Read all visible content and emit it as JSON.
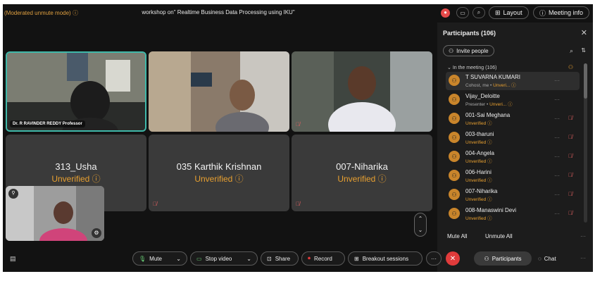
{
  "top": {
    "moderated_mode": "(Moderated unmute mode) ⓘ",
    "meeting_title": "workshop on\" Realtime Business Data Processing using IKU\"",
    "rec_dot": "⏺",
    "layout_label": "Layout",
    "meeting_info_label": "Meeting info"
  },
  "tiles": [
    {
      "name": "Dr. R RAVINDER REDDY Professor"
    },
    {
      "name": ""
    },
    {
      "name": ""
    },
    {
      "name": "313_Usha",
      "status": "Unverified ⓘ"
    },
    {
      "name": "035 Karthik Krishnan",
      "status": "Unverified ⓘ"
    },
    {
      "name": "007-Niharika",
      "status": "Unverified ⓘ"
    }
  ],
  "panel": {
    "title": "Participants (106)",
    "invite_label": "Invite people",
    "section": "In the meeting (106)",
    "participants": [
      {
        "name": "T SUVARNA KUMARI",
        "role": "Cohost, me",
        "status": "Unveri... ⓘ"
      },
      {
        "name": "Vijay_Deloitte",
        "role": "Presenter",
        "status": "Unveri... ⓘ"
      },
      {
        "name": "001-Sai Meghana",
        "role": "",
        "status": "Unverified ⓘ"
      },
      {
        "name": "003-tharuni",
        "role": "",
        "status": "Unverified ⓘ"
      },
      {
        "name": "004-Angela",
        "role": "",
        "status": "Unverified ⓘ"
      },
      {
        "name": "006-Harini",
        "role": "",
        "status": "Unverified ⓘ"
      },
      {
        "name": "007-Niharika",
        "role": "",
        "status": "Unverified ⓘ"
      },
      {
        "name": "008-Manaswini Devi",
        "role": "",
        "status": "Unverified ⓘ"
      }
    ],
    "mute_all": "Mute All",
    "unmute_all": "Unmute All"
  },
  "controls": {
    "mute": "Mute",
    "stop_video": "Stop video",
    "share": "Share",
    "record": "Record",
    "breakout": "Breakout sessions",
    "participants": "Participants",
    "chat": "Chat"
  },
  "colors": {
    "accent_orange": "#e8a030",
    "active_border": "#3fb8a9",
    "end_red": "#e03b3b"
  }
}
